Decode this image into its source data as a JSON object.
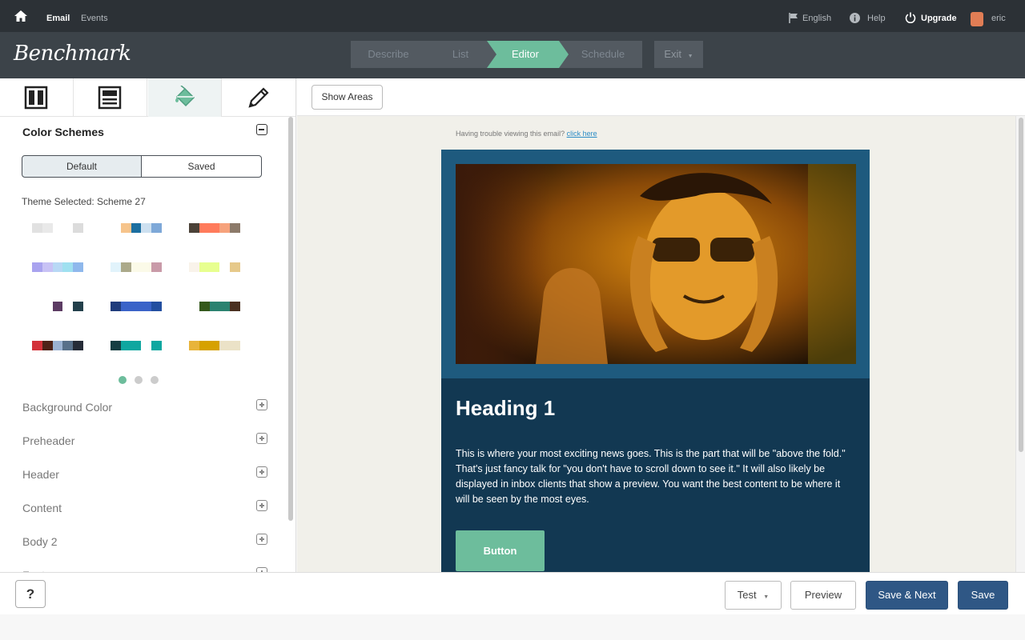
{
  "topnav": {
    "email": "Email",
    "events": "Events",
    "language": "English",
    "help": "Help",
    "upgrade": "Upgrade",
    "user": "eric"
  },
  "header": {
    "logo": "Benchmark",
    "steps": [
      "Describe",
      "List",
      "Editor",
      "Schedule"
    ],
    "active_step": "Editor",
    "exit": "Exit"
  },
  "sidebar": {
    "section_title": "Color Schemes",
    "segments": {
      "default": "Default",
      "saved": "Saved"
    },
    "theme_selected": "Theme Selected: Scheme 27",
    "swatches": [
      [
        "#e1e1e1",
        "#e9e9e9",
        "#ffffff",
        "#ffffff",
        "#dcdcdc"
      ],
      [
        "#ffffff",
        "#f6c48b",
        "#1c6fa0",
        "#cde0f0",
        "#7ea8d8"
      ],
      [
        "#4b4238",
        "#ff7b5c",
        "#ff7b5c",
        "#f6a27c",
        "#8c7a6a"
      ],
      [
        "#a9a3ef",
        "#c8c2f5",
        "#b8d8f5",
        "#9fe0f0",
        "#8fb8ec"
      ],
      [
        "#e1f3fb",
        "#aba98a",
        "#fbfae8",
        "#fbfae8",
        "#c99aa8"
      ],
      [
        "#f9f3ea",
        "#e7ff8f",
        "#e7ff8f",
        "#ffffff",
        "#e6c98a"
      ],
      [
        "#ffffff",
        "#ffffff",
        "#5c3b63",
        "#ffffff",
        "#23404b"
      ],
      [
        "#1f3c7c",
        "#3a63c8",
        "#3a63c8",
        "#3a63c8",
        "#234fa0"
      ],
      [
        "#ffffff",
        "#35591c",
        "#2b8270",
        "#2b8270",
        "#4a3020"
      ],
      [
        "#d3323a",
        "#4e2318",
        "#9bb2d2",
        "#58708a",
        "#262c38"
      ],
      [
        "#163e42",
        "#0fa7a0",
        "#0fa7a0",
        "#ffffff",
        "#0fa7a0"
      ],
      [
        "#e8b43a",
        "#d6a100",
        "#d6a100",
        "#ebe2c7",
        "#ebe2c7"
      ]
    ],
    "accordion": [
      "Background Color",
      "Preheader",
      "Header",
      "Content",
      "Body 2",
      "Footer"
    ]
  },
  "canvas": {
    "show_areas": "Show Areas",
    "trouble_text": "Having trouble viewing this email?",
    "trouble_link": "click here",
    "heading": "Heading 1",
    "paragraph": "This is where your most exciting news goes. This is the part that will be \"above the fold.\" That's just fancy talk for \"you don't have to scroll down to see it.\" It will also likely be displayed in inbox clients that show a preview. You want the best content to be where it will be seen by the most eyes.",
    "button": "Button"
  },
  "footer": {
    "help": "?",
    "test": "Test",
    "preview": "Preview",
    "save_next": "Save & Next",
    "save": "Save"
  },
  "colors": {
    "accent": "#6dbd9c",
    "primary": "#2f5785",
    "email_header_bg": "#1e5a7e",
    "email_body_bg": "#123852"
  }
}
